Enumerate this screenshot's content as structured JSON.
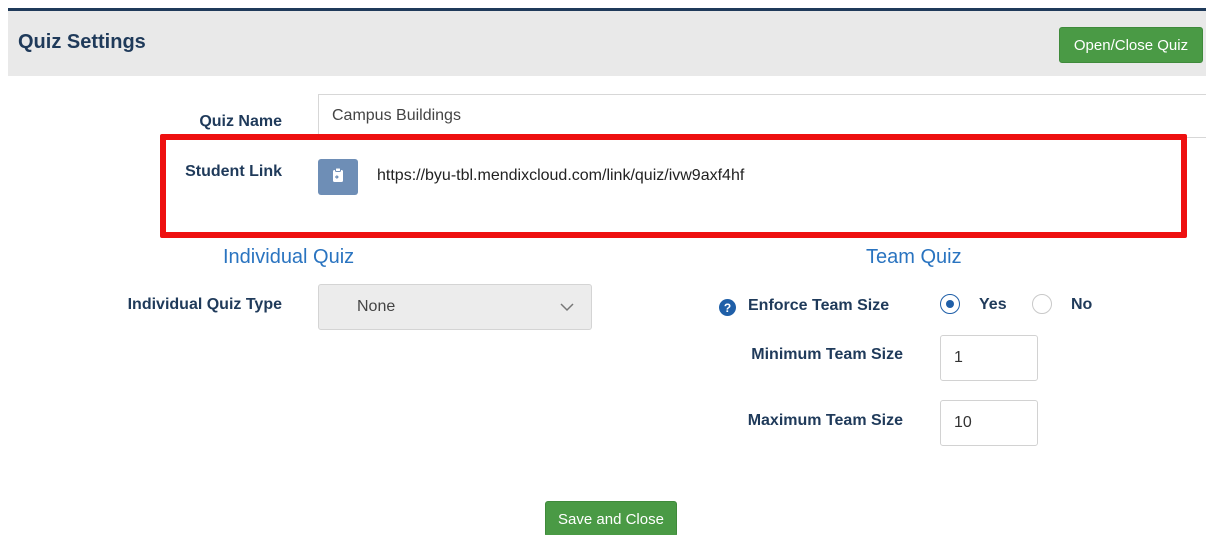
{
  "header": {
    "title": "Quiz Settings",
    "open_close_label": "Open/Close Quiz"
  },
  "form": {
    "quiz_name_label": "Quiz Name",
    "quiz_name_value": "Campus Buildings",
    "student_link_label": "Student Link",
    "student_link_url": "https://byu-tbl.mendixcloud.com/link/quiz/ivw9axf4hf",
    "copy_icon": "clipboard-icon"
  },
  "individual_quiz": {
    "title": "Individual Quiz",
    "type_label": "Individual Quiz Type",
    "type_value": "None"
  },
  "team_quiz": {
    "title": "Team Quiz",
    "enforce_label": "Enforce Team Size",
    "help_icon": "question-circle-icon",
    "yes_label": "Yes",
    "no_label": "No",
    "enforce_selected": "Yes",
    "min_label": "Minimum Team Size",
    "min_value": "1",
    "max_label": "Maximum Team Size",
    "max_value": "10"
  },
  "footer": {
    "save_close_label": "Save and Close"
  },
  "colors": {
    "accent_green": "#4a9a45",
    "title_navy": "#1f3a5a",
    "section_blue": "#2a74c0",
    "highlight_red": "#ee1010"
  }
}
